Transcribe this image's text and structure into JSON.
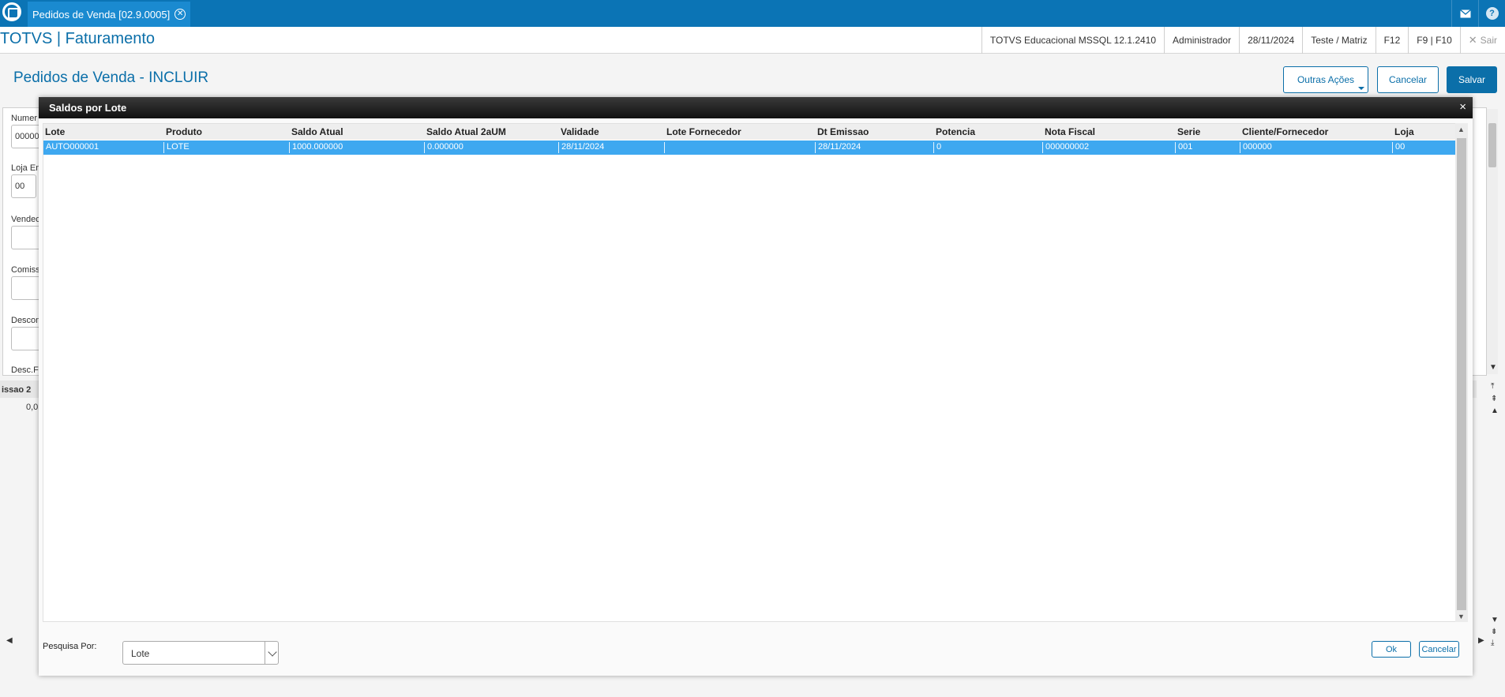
{
  "topbar": {
    "tab_label": "Pedidos de Venda [02.9.0005]",
    "tab_close": "✕",
    "mail_icon": "mail-icon",
    "help_label": "?"
  },
  "header": {
    "app_title": "TOTVS | Faturamento",
    "environment": "TOTVS Educacional MSSQL 12.1.2410",
    "user": "Administrador",
    "date": "28/11/2024",
    "branch": "Teste / Matriz",
    "f12": "F12",
    "f9f10": "F9 | F10",
    "sair": "Sair"
  },
  "page": {
    "title": "Pedidos de Venda - INCLUIR",
    "outras_acoes": "Outras Ações",
    "cancelar": "Cancelar",
    "salvar": "Salvar"
  },
  "background_form": {
    "numero_label": "Numer",
    "numero_value": "00000",
    "loja_label": "Loja En",
    "loja_value": "00",
    "vendedor_label": "Vended",
    "comissao_label": "Comiss",
    "desconto_label": "Descon",
    "descf_label": "Desc.F",
    "grid_header": "issao 2",
    "grid_value": "0,0"
  },
  "modal": {
    "title": "Saldos por Lote",
    "close": "×",
    "columns": [
      "Lote",
      "Produto",
      "Saldo Atual",
      "Saldo Atual 2aUM",
      "Validade",
      "Lote Fornecedor",
      "Dt Emissao",
      "Potencia",
      "Nota Fiscal",
      "Serie",
      "Cliente/Fornecedor",
      "Loja"
    ],
    "rows": [
      [
        "AUTO000001",
        "LOTE",
        "1000.000000",
        "0.000000",
        "28/11/2024",
        "",
        "28/11/2024",
        "0",
        "000000002",
        "001",
        "000000",
        "00"
      ]
    ],
    "search_label": "Pesquisa Por:",
    "search_value": "Lote",
    "ok_label": "Ok",
    "cancel_label": "Cancelar"
  }
}
